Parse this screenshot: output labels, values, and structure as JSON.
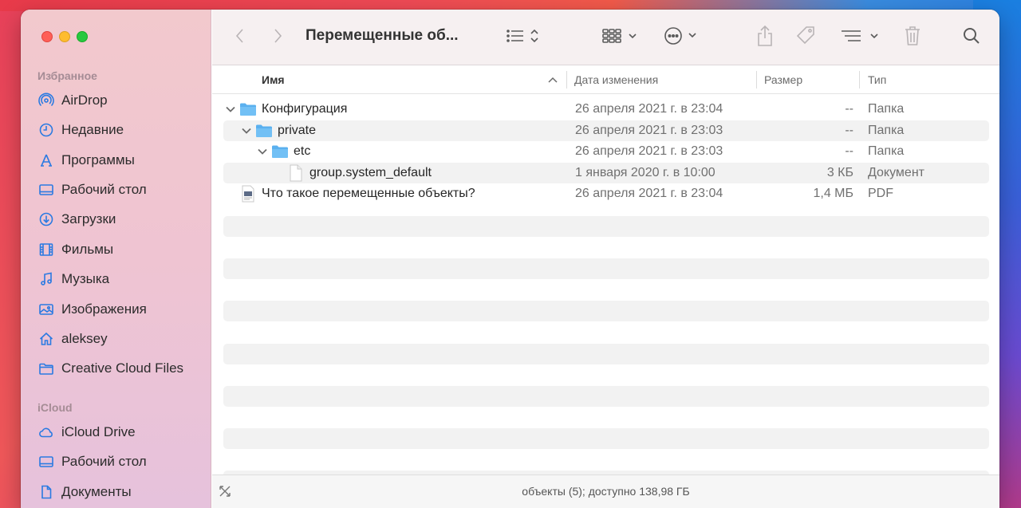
{
  "window": {
    "title": "Перемещенные об..."
  },
  "sidebar": {
    "favorites_label": "Избранное",
    "favorites": [
      {
        "label": "AirDrop",
        "icon": "airdrop-icon"
      },
      {
        "label": "Недавние",
        "icon": "clock-icon"
      },
      {
        "label": "Программы",
        "icon": "applications-icon"
      },
      {
        "label": "Рабочий стол",
        "icon": "desktop-icon"
      },
      {
        "label": "Загрузки",
        "icon": "download-icon"
      },
      {
        "label": "Фильмы",
        "icon": "film-icon"
      },
      {
        "label": "Музыка",
        "icon": "music-icon"
      },
      {
        "label": "Изображения",
        "icon": "photo-icon"
      },
      {
        "label": "aleksey",
        "icon": "home-icon"
      },
      {
        "label": "Creative Cloud Files",
        "icon": "folder-icon"
      }
    ],
    "icloud_label": "iCloud",
    "icloud": [
      {
        "label": "iCloud Drive",
        "icon": "cloud-icon"
      },
      {
        "label": "Рабочий стол",
        "icon": "desktop-icon"
      },
      {
        "label": "Документы",
        "icon": "document-icon"
      }
    ]
  },
  "columns": {
    "name": "Имя",
    "modified": "Дата изменения",
    "size": "Размер",
    "kind": "Тип"
  },
  "rows": [
    {
      "name": "Конфигурация",
      "date": "26 апреля 2021 г. в 23:04",
      "size": "--",
      "kind": "Папка",
      "type": "folder",
      "level": 0,
      "expanded": true
    },
    {
      "name": "private",
      "date": "26 апреля 2021 г. в 23:03",
      "size": "--",
      "kind": "Папка",
      "type": "folder",
      "level": 1,
      "expanded": true
    },
    {
      "name": "etc",
      "date": "26 апреля 2021 г. в 23:03",
      "size": "--",
      "kind": "Папка",
      "type": "folder",
      "level": 2,
      "expanded": true
    },
    {
      "name": "group.system_default",
      "date": "1 января 2020 г. в 10:00",
      "size": "3 КБ",
      "kind": "Документ",
      "type": "file",
      "level": 3
    },
    {
      "name": "Что такое перемещенные объекты?",
      "date": "26 апреля 2021 г. в 23:04",
      "size": "1,4 МБ",
      "kind": "PDF",
      "type": "pdf",
      "level": 0
    }
  ],
  "status": {
    "text": "объекты (5); доступно 138,98 ГБ"
  },
  "colors": {
    "accent": "#2a7ae2",
    "folder": "#5ab0ef"
  }
}
